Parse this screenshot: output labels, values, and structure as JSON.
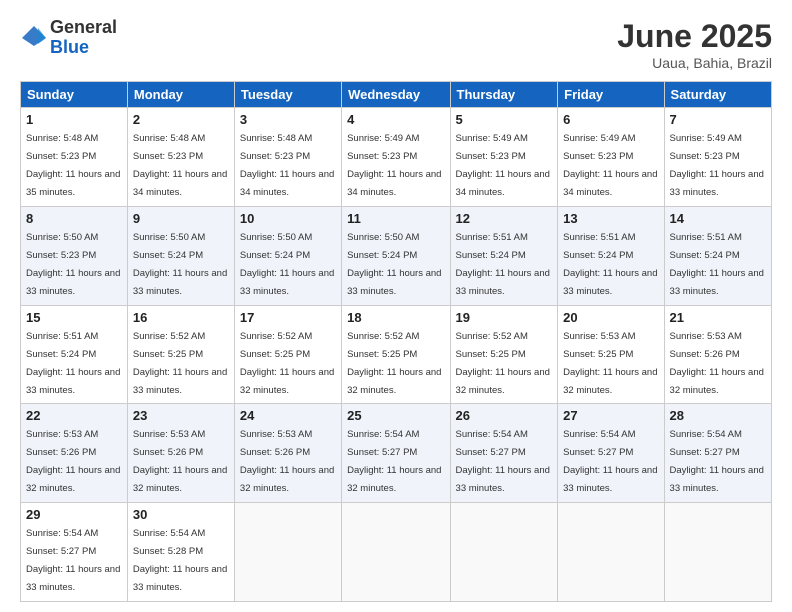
{
  "header": {
    "logo_general": "General",
    "logo_blue": "Blue",
    "month_title": "June 2025",
    "location": "Uaua, Bahia, Brazil"
  },
  "weekdays": [
    "Sunday",
    "Monday",
    "Tuesday",
    "Wednesday",
    "Thursday",
    "Friday",
    "Saturday"
  ],
  "weeks": [
    [
      {
        "day": "1",
        "sunrise": "5:48 AM",
        "sunset": "5:23 PM",
        "daylight": "11 hours and 35 minutes."
      },
      {
        "day": "2",
        "sunrise": "5:48 AM",
        "sunset": "5:23 PM",
        "daylight": "11 hours and 34 minutes."
      },
      {
        "day": "3",
        "sunrise": "5:48 AM",
        "sunset": "5:23 PM",
        "daylight": "11 hours and 34 minutes."
      },
      {
        "day": "4",
        "sunrise": "5:49 AM",
        "sunset": "5:23 PM",
        "daylight": "11 hours and 34 minutes."
      },
      {
        "day": "5",
        "sunrise": "5:49 AM",
        "sunset": "5:23 PM",
        "daylight": "11 hours and 34 minutes."
      },
      {
        "day": "6",
        "sunrise": "5:49 AM",
        "sunset": "5:23 PM",
        "daylight": "11 hours and 34 minutes."
      },
      {
        "day": "7",
        "sunrise": "5:49 AM",
        "sunset": "5:23 PM",
        "daylight": "11 hours and 33 minutes."
      }
    ],
    [
      {
        "day": "8",
        "sunrise": "5:50 AM",
        "sunset": "5:23 PM",
        "daylight": "11 hours and 33 minutes."
      },
      {
        "day": "9",
        "sunrise": "5:50 AM",
        "sunset": "5:24 PM",
        "daylight": "11 hours and 33 minutes."
      },
      {
        "day": "10",
        "sunrise": "5:50 AM",
        "sunset": "5:24 PM",
        "daylight": "11 hours and 33 minutes."
      },
      {
        "day": "11",
        "sunrise": "5:50 AM",
        "sunset": "5:24 PM",
        "daylight": "11 hours and 33 minutes."
      },
      {
        "day": "12",
        "sunrise": "5:51 AM",
        "sunset": "5:24 PM",
        "daylight": "11 hours and 33 minutes."
      },
      {
        "day": "13",
        "sunrise": "5:51 AM",
        "sunset": "5:24 PM",
        "daylight": "11 hours and 33 minutes."
      },
      {
        "day": "14",
        "sunrise": "5:51 AM",
        "sunset": "5:24 PM",
        "daylight": "11 hours and 33 minutes."
      }
    ],
    [
      {
        "day": "15",
        "sunrise": "5:51 AM",
        "sunset": "5:24 PM",
        "daylight": "11 hours and 33 minutes."
      },
      {
        "day": "16",
        "sunrise": "5:52 AM",
        "sunset": "5:25 PM",
        "daylight": "11 hours and 33 minutes."
      },
      {
        "day": "17",
        "sunrise": "5:52 AM",
        "sunset": "5:25 PM",
        "daylight": "11 hours and 32 minutes."
      },
      {
        "day": "18",
        "sunrise": "5:52 AM",
        "sunset": "5:25 PM",
        "daylight": "11 hours and 32 minutes."
      },
      {
        "day": "19",
        "sunrise": "5:52 AM",
        "sunset": "5:25 PM",
        "daylight": "11 hours and 32 minutes."
      },
      {
        "day": "20",
        "sunrise": "5:53 AM",
        "sunset": "5:25 PM",
        "daylight": "11 hours and 32 minutes."
      },
      {
        "day": "21",
        "sunrise": "5:53 AM",
        "sunset": "5:26 PM",
        "daylight": "11 hours and 32 minutes."
      }
    ],
    [
      {
        "day": "22",
        "sunrise": "5:53 AM",
        "sunset": "5:26 PM",
        "daylight": "11 hours and 32 minutes."
      },
      {
        "day": "23",
        "sunrise": "5:53 AM",
        "sunset": "5:26 PM",
        "daylight": "11 hours and 32 minutes."
      },
      {
        "day": "24",
        "sunrise": "5:53 AM",
        "sunset": "5:26 PM",
        "daylight": "11 hours and 32 minutes."
      },
      {
        "day": "25",
        "sunrise": "5:54 AM",
        "sunset": "5:27 PM",
        "daylight": "11 hours and 32 minutes."
      },
      {
        "day": "26",
        "sunrise": "5:54 AM",
        "sunset": "5:27 PM",
        "daylight": "11 hours and 33 minutes."
      },
      {
        "day": "27",
        "sunrise": "5:54 AM",
        "sunset": "5:27 PM",
        "daylight": "11 hours and 33 minutes."
      },
      {
        "day": "28",
        "sunrise": "5:54 AM",
        "sunset": "5:27 PM",
        "daylight": "11 hours and 33 minutes."
      }
    ],
    [
      {
        "day": "29",
        "sunrise": "5:54 AM",
        "sunset": "5:27 PM",
        "daylight": "11 hours and 33 minutes."
      },
      {
        "day": "30",
        "sunrise": "5:54 AM",
        "sunset": "5:28 PM",
        "daylight": "11 hours and 33 minutes."
      },
      null,
      null,
      null,
      null,
      null
    ]
  ]
}
